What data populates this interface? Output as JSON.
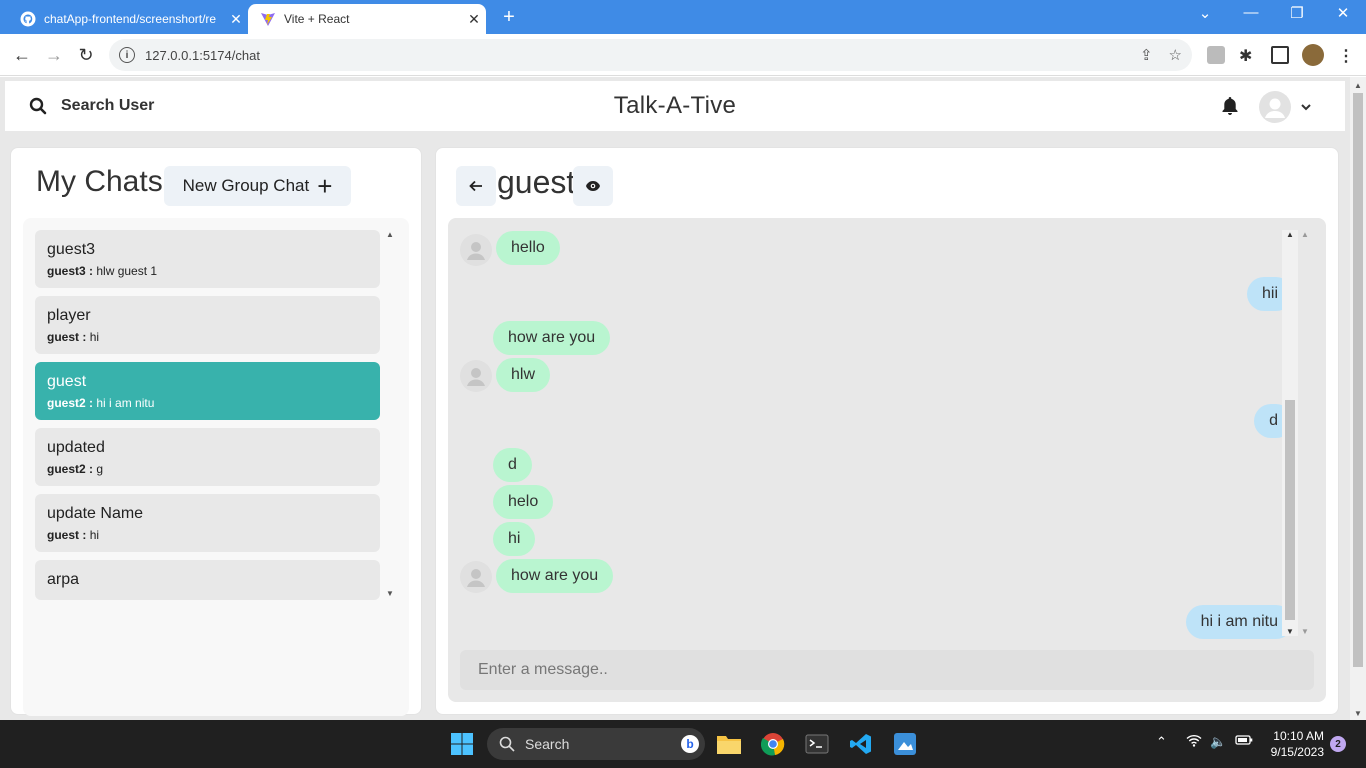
{
  "browser": {
    "tabs": [
      {
        "title": "chatApp-frontend/screenshort/re",
        "active": false
      },
      {
        "title": "Vite + React",
        "active": true
      }
    ],
    "url": "127.0.0.1:5174/chat"
  },
  "header": {
    "search_label": "Search User",
    "brand": "Talk-A-Tive"
  },
  "sidebar": {
    "title": "My Chats",
    "new_group_label": "New Group Chat",
    "new_group_plus": "+",
    "chats": [
      {
        "name": "guest3",
        "sender": "guest3 :",
        "latest": "hlw guest 1",
        "active": false
      },
      {
        "name": "player",
        "sender": "guest :",
        "latest": "hi",
        "active": false
      },
      {
        "name": "guest",
        "sender": "guest2 :",
        "latest": "hi i am nitu",
        "active": true
      },
      {
        "name": "updated",
        "sender": "guest2 :",
        "latest": "g",
        "active": false
      },
      {
        "name": "update Name",
        "sender": "guest :",
        "latest": "hi",
        "active": false
      },
      {
        "name": "arpa",
        "sender": "",
        "latest": "",
        "active": false
      }
    ]
  },
  "chat": {
    "title": "guest",
    "input_placeholder": "Enter a message..",
    "messages": [
      {
        "text": "hello",
        "dir": "in",
        "avatar": true
      },
      {
        "text": "hii",
        "dir": "out",
        "avatar": false
      },
      {
        "text": "how are you",
        "dir": "in",
        "avatar": false
      },
      {
        "text": "hlw",
        "dir": "in",
        "avatar": true
      },
      {
        "text": "d",
        "dir": "out",
        "avatar": false
      },
      {
        "text": "d",
        "dir": "in",
        "avatar": false
      },
      {
        "text": "helo",
        "dir": "in",
        "avatar": false
      },
      {
        "text": "hi",
        "dir": "in",
        "avatar": false
      },
      {
        "text": "how are you",
        "dir": "in",
        "avatar": true
      },
      {
        "text": "hi i am nitu",
        "dir": "out",
        "avatar": false
      }
    ]
  },
  "taskbar": {
    "search_label": "Search",
    "time": "10:10 AM",
    "date": "9/15/2023",
    "notification_count": "2"
  },
  "colors": {
    "active_chat": "#38b2ac",
    "incoming_bubble": "#b9f5d0",
    "outgoing_bubble": "#bee3f8",
    "tabbar": "#3f8be6"
  }
}
